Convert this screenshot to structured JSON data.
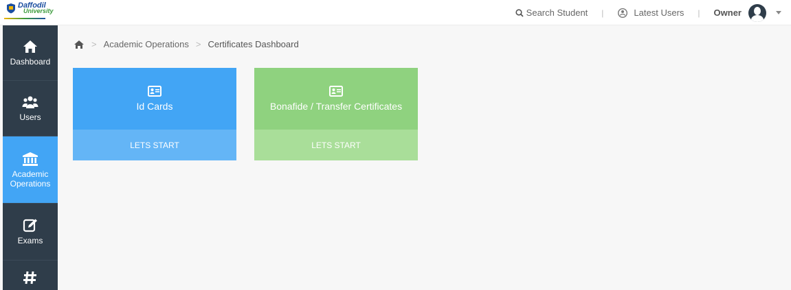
{
  "logo": {
    "line1": "Daffodil",
    "line2": "University"
  },
  "topbar": {
    "search_label": "Search Student",
    "latest_users_label": "Latest Users",
    "separator": "|",
    "owner_label": "Owner"
  },
  "sidebar": {
    "items": [
      {
        "label": "Dashboard",
        "icon": "home-icon"
      },
      {
        "label": "Users",
        "icon": "users-icon"
      },
      {
        "label": "Academic Operations",
        "icon": "bank-icon"
      },
      {
        "label": "Exams",
        "icon": "edit-icon"
      },
      {
        "label": "",
        "icon": "hash-icon"
      }
    ]
  },
  "breadcrumb": {
    "items": [
      "Academic Operations",
      "Certificates Dashboard"
    ],
    "separator": ">"
  },
  "cards": [
    {
      "title": "Id Cards",
      "action": "LETS START",
      "color": "#42a5f5",
      "icon": "id-card-icon"
    },
    {
      "title": "Bonafide / Transfer Certificates",
      "action": "LETS START",
      "color": "#8fd27f",
      "icon": "id-card-icon"
    }
  ],
  "colors": {
    "sidebar_bg": "#2f3d4a",
    "active": "#42a5f5",
    "accent_green": "#8fd27f"
  }
}
